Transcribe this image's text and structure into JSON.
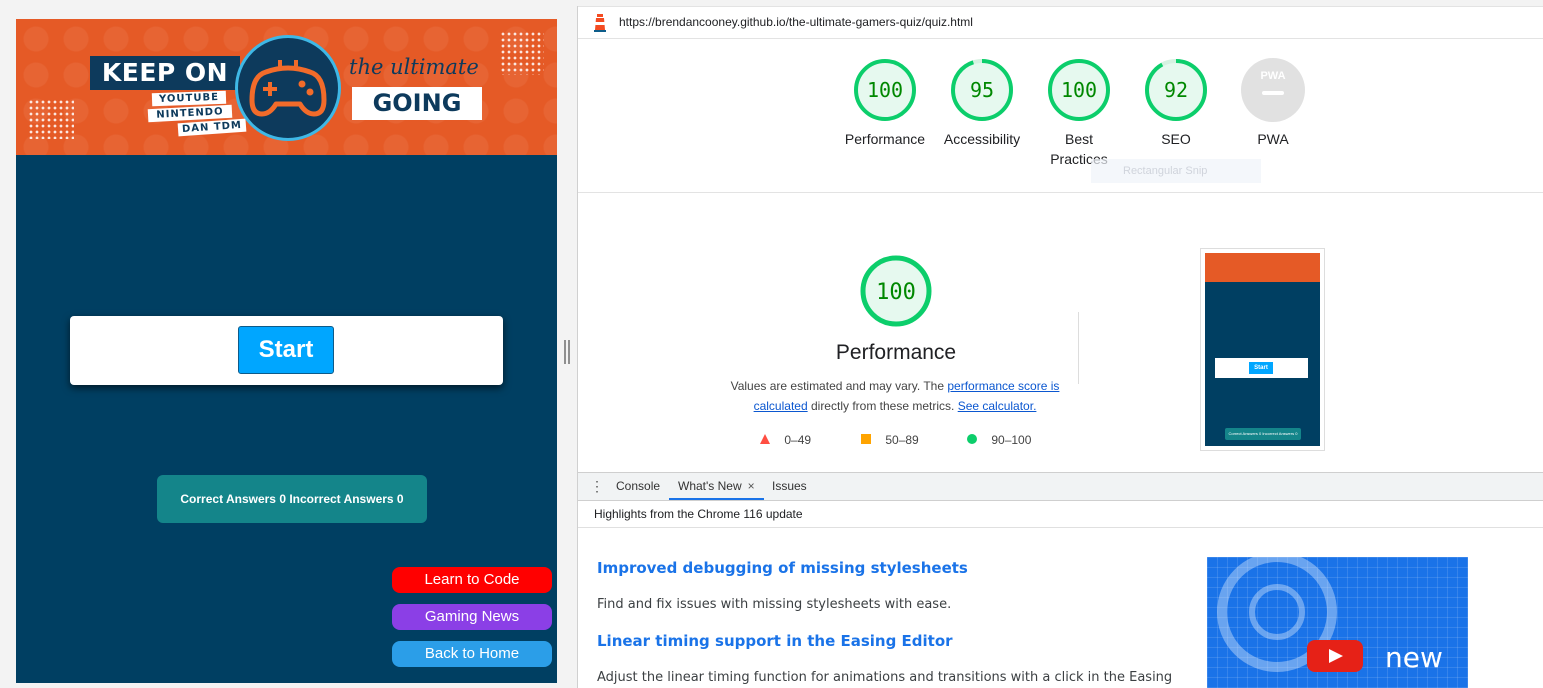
{
  "quiz": {
    "banner": {
      "keep_on": "KEEP ON",
      "tags": [
        "YOUTUBE",
        "NINTENDO",
        "DAN TDM"
      ],
      "the_ultimate": "the ultimate",
      "going": "GOING"
    },
    "start_label": "Start",
    "score_text": "Correct Answers 0 Incorrect Answers 0",
    "links": {
      "learn": "Learn to Code",
      "news": "Gaming News",
      "home": "Back to Home"
    },
    "colors": {
      "background": "#003f62",
      "banner": "#e55a26",
      "start": "#00a6ff",
      "score": "#14858a",
      "learn": "#ff0000",
      "news": "#8b3fe6",
      "home": "#2b9ee8"
    }
  },
  "devtools": {
    "url": "https://brendancooney.github.io/the-ultimate-gamers-quiz/quiz.html",
    "gauges": [
      {
        "score": "100",
        "label": "Performance",
        "value": 100
      },
      {
        "score": "95",
        "label": "Accessibility",
        "value": 95
      },
      {
        "score": "100",
        "label": "Best Practices",
        "value": 100
      },
      {
        "score": "92",
        "label": "SEO",
        "value": 92
      },
      {
        "score": "PWA",
        "label": "PWA",
        "value": null
      }
    ],
    "faint_overlay": "Rectangular Snip",
    "performance": {
      "score": "100",
      "title": "Performance",
      "desc_prefix": "Values are estimated and may vary. The ",
      "desc_link1": "performance score is calculated",
      "desc_middle": " directly from these metrics. ",
      "desc_link2": "See calculator.",
      "legend": [
        "0–49",
        "50–89",
        "90–100"
      ]
    },
    "thumbnail": {
      "start": "Start",
      "score": "Correct Answers 0 Incorrect Answers 0"
    },
    "tabs": {
      "console": "Console",
      "whats_new": "What's New",
      "close": "×",
      "issues": "Issues"
    },
    "highlights": "Highlights from the Chrome 116 update",
    "news": [
      {
        "title": "Improved debugging of missing stylesheets",
        "desc": "Find and fix issues with missing stylesheets with ease."
      },
      {
        "title": "Linear timing support in the Easing Editor",
        "desc": "Adjust the linear timing function for animations and transitions with a click in the Easing"
      }
    ],
    "video_text": "new",
    "colors": {
      "good": "#0cce6b",
      "good_text": "#008800",
      "average": "#ffa400",
      "poor": "#ff4e42",
      "link": "#1a73e8"
    }
  }
}
